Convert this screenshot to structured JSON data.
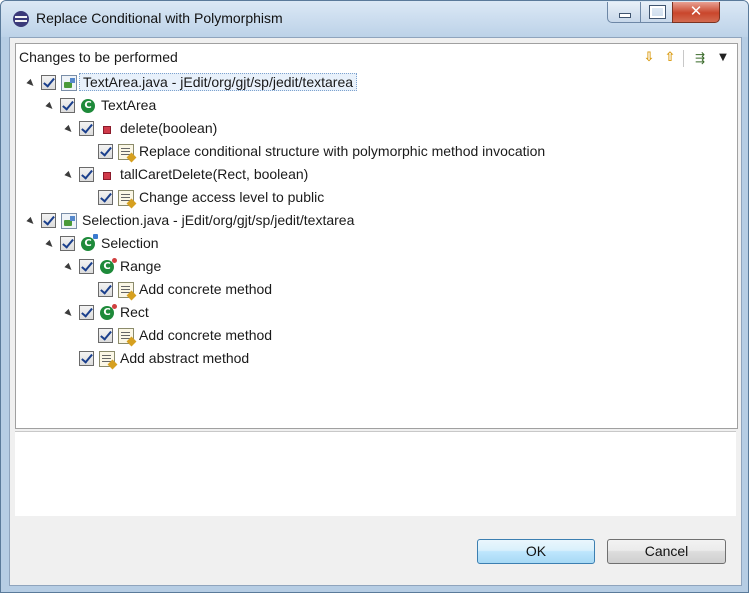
{
  "window": {
    "title": "Replace Conditional with Polymorphism",
    "close_glyph": "✕"
  },
  "panel": {
    "title": "Changes to be performed",
    "toolbar": {
      "next_icon": "⇩",
      "prev_icon": "⇧",
      "filter_icon": "⇶",
      "menu_icon": "▼"
    }
  },
  "tree": [
    {
      "label": "TextArea.java - jEdit/org/gjt/sp/jedit/textarea",
      "icon": "java-file-icon",
      "checked": true
    },
    {
      "label": "TextArea",
      "icon": "class-icon",
      "checked": true
    },
    {
      "label": "delete(boolean)",
      "icon": "private-method-icon",
      "checked": true
    },
    {
      "label": "Replace conditional structure with polymorphic method invocation",
      "icon": "change-icon",
      "checked": true
    },
    {
      "label": "tallCaretDelete(Rect, boolean)",
      "icon": "private-method-icon",
      "checked": true
    },
    {
      "label": "Change access level to public",
      "icon": "change-icon",
      "checked": true
    },
    {
      "label": "Selection.java - jEdit/org/gjt/sp/jedit/textarea",
      "icon": "java-file-icon",
      "checked": true
    },
    {
      "label": "Selection",
      "icon": "abstract-class-icon",
      "checked": true
    },
    {
      "label": "Range",
      "icon": "inner-class-icon",
      "checked": true
    },
    {
      "label": "Add concrete method",
      "icon": "change-icon",
      "checked": true
    },
    {
      "label": "Rect",
      "icon": "inner-class-icon",
      "checked": true
    },
    {
      "label": "Add concrete method",
      "icon": "change-icon",
      "checked": true
    },
    {
      "label": "Add abstract method",
      "icon": "change-icon",
      "checked": true
    }
  ],
  "buttons": {
    "ok": "OK",
    "cancel": "Cancel"
  }
}
